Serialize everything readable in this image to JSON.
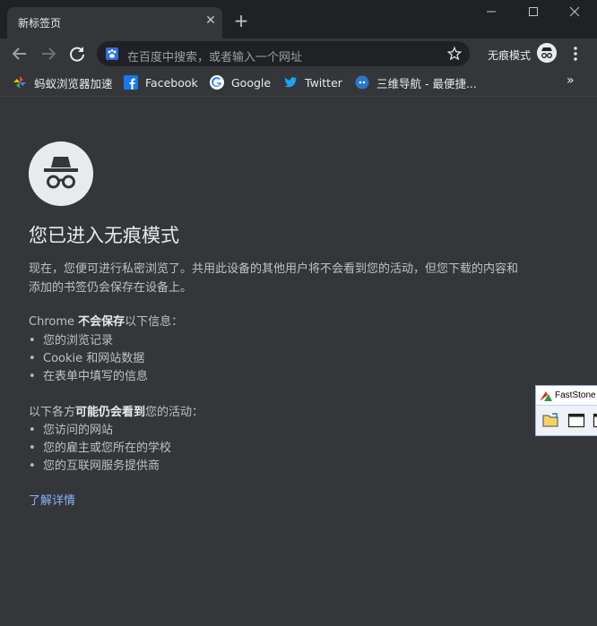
{
  "tab": {
    "title": "新标签页",
    "close_icon": "close-icon"
  },
  "window_controls": {
    "minimize": "minimize-icon",
    "maximize": "maximize-icon",
    "close": "close-icon"
  },
  "toolbar": {
    "back_icon": "arrow-left-icon",
    "forward_icon": "arrow-right-icon",
    "reload_icon": "reload-icon",
    "omnibox_placeholder": "在百度中搜索，或者输入一个网址",
    "bookmark_star_icon": "star-icon",
    "incognito_label": "无痕模式",
    "menu_icon": "vertical-dots-icon"
  },
  "bookmarks": [
    {
      "label": "蚂蚁浏览器加速",
      "icon": "pinwheel-icon"
    },
    {
      "label": "Facebook",
      "icon": "facebook-icon"
    },
    {
      "label": "Google",
      "icon": "google-icon"
    },
    {
      "label": "Twitter",
      "icon": "twitter-icon"
    },
    {
      "label": "三维导航 - 最便捷...",
      "icon": "globe-icon"
    }
  ],
  "bookmarks_overflow": "»",
  "page": {
    "heading": "您已进入无痕模式",
    "intro_line1": "现在，您便可进行私密浏览了。共用此设备的其他用户将不会看到您的活动，但您下载的内容和",
    "intro_line2": "添加的书签仍会保存在设备上。",
    "not_saved_prefix": "Chrome ",
    "not_saved_bold": "不会保存",
    "not_saved_suffix": "以下信息：",
    "not_saved_items": [
      "您的浏览记录",
      "Cookie 和网站数据",
      "在表单中填写的信息"
    ],
    "visible_prefix": "以下各方",
    "visible_bold": "可能仍会看到",
    "visible_suffix": "您的活动：",
    "visible_items": [
      "您访问的网站",
      "您的雇主或您所在的学校",
      "您的互联网服务提供商"
    ],
    "learn_more": "了解详情"
  },
  "faststone": {
    "title": "FastStone",
    "tools": [
      "open-folder-icon",
      "window-capture-icon",
      "window-capture-icon"
    ]
  },
  "colors": {
    "background": "#35363a",
    "tabstrip": "#202124",
    "link": "#8ab4f8",
    "text": "#e8eaed",
    "muted": "#bdc1c6"
  }
}
